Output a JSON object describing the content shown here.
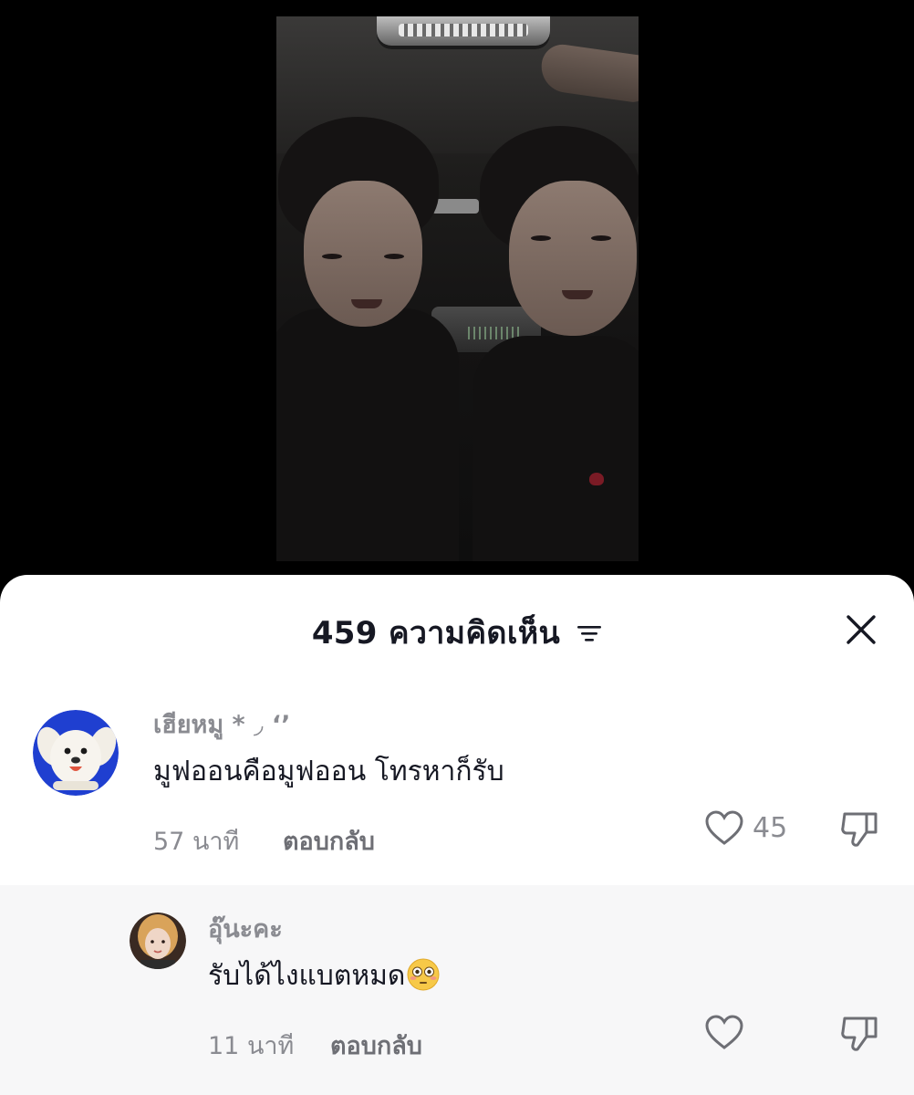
{
  "comments_panel": {
    "title": "459 ความคิดเห็น",
    "sort_icon": "sort-lines-icon",
    "close_icon": "close-icon"
  },
  "comments": [
    {
      "username": "เฮียหมู * ◞ ‘’",
      "text": "มูฟออนคือมูฟออน โทรหาก็รับ",
      "time": "57 นาที",
      "reply_label": "ตอบกลับ",
      "likes": "45",
      "avatar": "dog-avatar"
    },
    {
      "username": "อุ๊นะคะ",
      "text": "รับได้ไงแบตหมด",
      "emoji": "flushed-face-emoji",
      "time": "11 นาที",
      "reply_label": "ตอบกลับ",
      "avatar": "person-avatar"
    }
  ],
  "colors": {
    "accent_text": "#161823",
    "muted_text": "#8a8b91",
    "emoji_face": "#f7c948"
  }
}
